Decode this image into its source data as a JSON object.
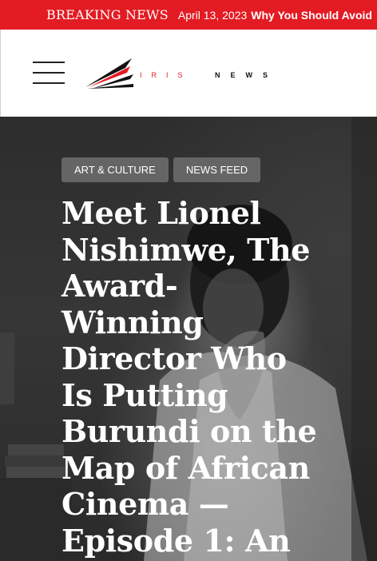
{
  "ticker": {
    "label": "BREAKING NEWS",
    "date": "April 13, 2023",
    "headline": "Why You Should Avoid"
  },
  "header": {
    "logo": {
      "word1": "IRIS",
      "word2": "NEWS"
    }
  },
  "hero": {
    "tags": [
      "ART & CULTURE",
      "NEWS FEED"
    ],
    "title_lines": [
      "Meet Lionel",
      "Nishimwe, The",
      "Award-",
      "Winning",
      "Director Who",
      "Is Putting",
      "Burundi on the",
      "Map of African",
      "Cinema —",
      "Episode 1: An"
    ]
  },
  "colors": {
    "accent": "#e31b23",
    "tag_bg": "#6e6e6e",
    "hero_dark": "#2d2d2d"
  },
  "icons": {
    "menu": "hamburger-icon"
  }
}
